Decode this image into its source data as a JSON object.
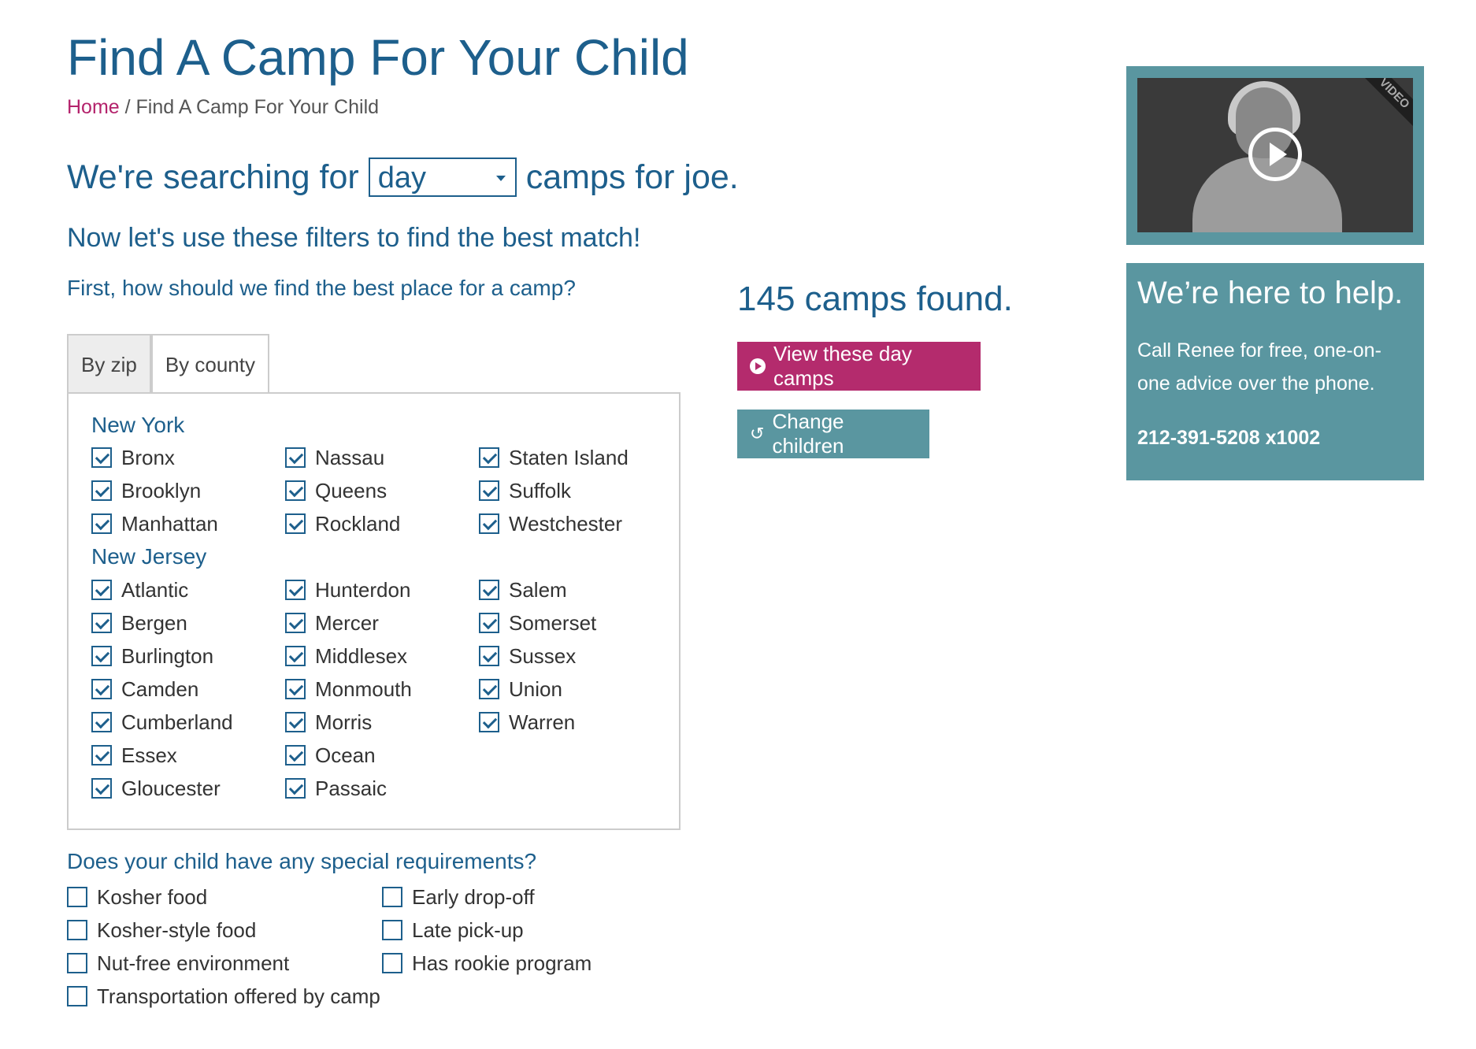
{
  "page": {
    "title": "Find A Camp For Your Child",
    "breadcrumb": {
      "home": "Home",
      "separator": " / ",
      "current": "Find A Camp For Your Child"
    }
  },
  "search": {
    "prefix": "We're searching for",
    "type_value": "day",
    "suffix": "camps for joe."
  },
  "subheading": "Now let's use these filters to find the best match!",
  "location_question": "First, how should we find the best place for a camp?",
  "tabs": [
    {
      "label": "By zip",
      "active": true
    },
    {
      "label": "By county",
      "active": false
    }
  ],
  "counties": {
    "new_york": {
      "label": "New York",
      "items": [
        "Bronx",
        "Nassau",
        "Staten Island",
        "Brooklyn",
        "Queens",
        "Suffolk",
        "Manhattan",
        "Rockland",
        "Westchester"
      ]
    },
    "new_jersey": {
      "label": "New Jersey",
      "items": [
        "Atlantic",
        "Hunterdon",
        "Salem",
        "Bergen",
        "Mercer",
        "Somerset",
        "Burlington",
        "Middlesex",
        "Sussex",
        "Camden",
        "Monmouth",
        "Union",
        "Cumberland",
        "Morris",
        "Warren",
        "Essex",
        "Ocean",
        "",
        "Gloucester",
        "Passaic",
        ""
      ]
    }
  },
  "requirements": {
    "question": "Does your child have any special requirements?",
    "items": [
      "Kosher food",
      "Early drop-off",
      "Kosher-style food",
      "Late pick-up",
      "Nut-free environment",
      "Has rookie program",
      "Transportation offered by camp"
    ]
  },
  "results": {
    "found_text": "145 camps found.",
    "view_button": "View these day camps",
    "change_button": "Change children"
  },
  "video": {
    "ribbon": "VIDEO"
  },
  "help": {
    "heading": "We’re here to help.",
    "text": "Call Renee for free, one-on-one advice over the phone.",
    "phone": "212-391-5208 x1002"
  },
  "colors": {
    "primary": "#1d5f8c",
    "accent": "#b42b6d",
    "teal": "#5a96a0"
  }
}
